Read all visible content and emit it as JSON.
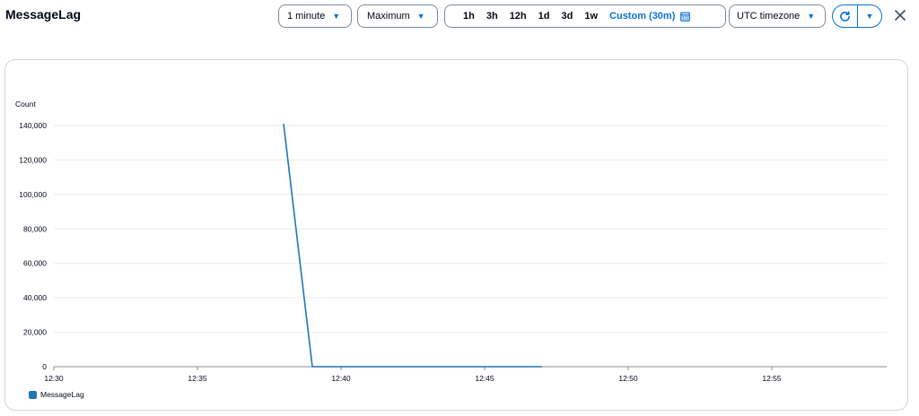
{
  "header": {
    "title": "MessageLag",
    "period_label": "1 minute",
    "statistic_label": "Maximum",
    "ranges": [
      "1h",
      "3h",
      "12h",
      "1d",
      "3d",
      "1w"
    ],
    "custom_range_label": "Custom (30m)",
    "timezone_label": "UTC timezone"
  },
  "icons": {
    "calendar": "calendar-icon",
    "refresh": "refresh-icon",
    "close": "close-icon",
    "caret": "caret-down-icon"
  },
  "colors": {
    "accent": "#0972d3",
    "series": "#1f77b4"
  },
  "chart_data": {
    "type": "line",
    "title": "",
    "ylabel": "Count",
    "xlabel": "",
    "x_ticks": [
      "12:30",
      "12:35",
      "12:40",
      "12:45",
      "12:50",
      "12:55"
    ],
    "y_ticks": [
      "0",
      "20,000",
      "40,000",
      "60,000",
      "80,000",
      "100,000",
      "120,000",
      "140,000"
    ],
    "ylim": [
      0,
      140000
    ],
    "xlim": [
      "12:30",
      "12:59"
    ],
    "grid": true,
    "legend_position": "bottom-left",
    "series": [
      {
        "name": "MessageLag",
        "color": "#1f77b4",
        "x": [
          "12:38",
          "12:39",
          "12:40",
          "12:41",
          "12:42",
          "12:43",
          "12:44",
          "12:45",
          "12:46",
          "12:47"
        ],
        "values": [
          141000,
          0,
          0,
          0,
          0,
          0,
          0,
          0,
          0,
          0
        ]
      }
    ]
  }
}
